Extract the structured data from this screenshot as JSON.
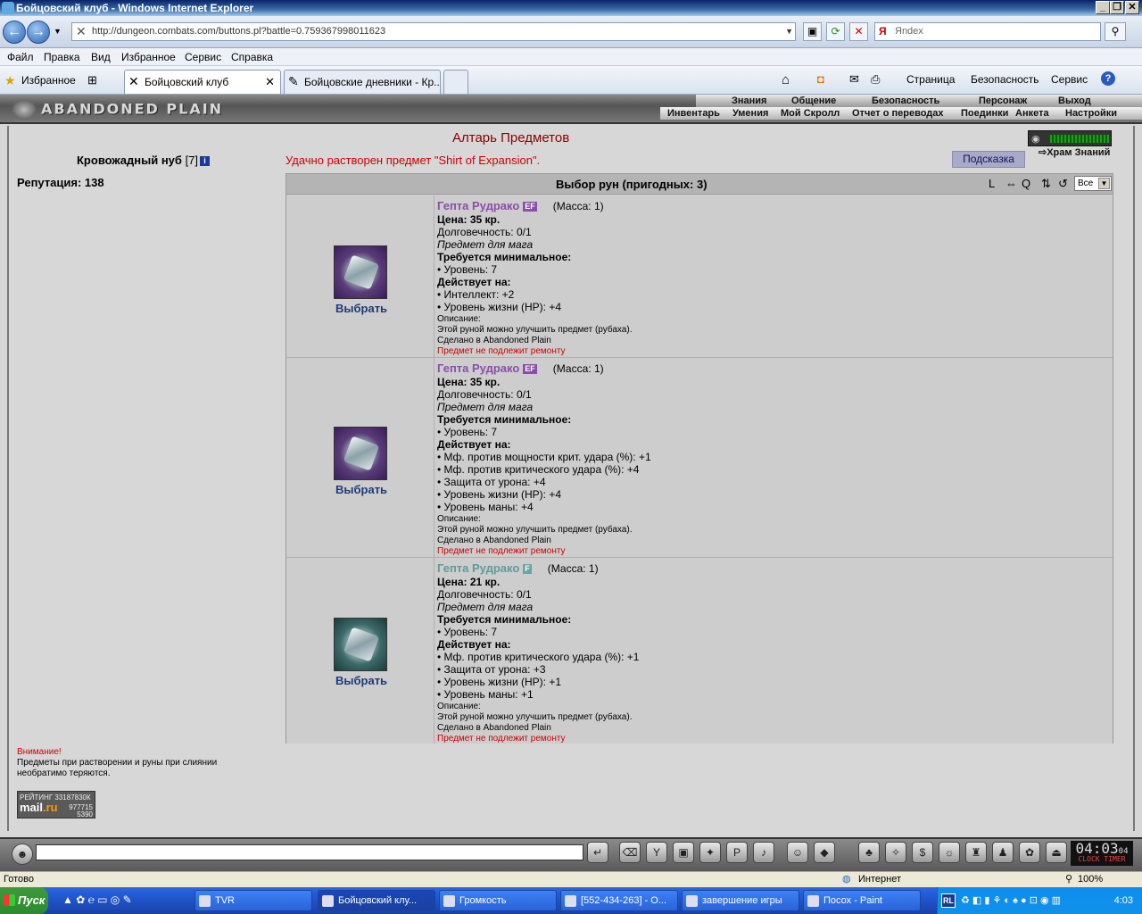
{
  "window": {
    "title": "Бойцовский клуб - Windows Internet Explorer"
  },
  "browser": {
    "url": "http://dungeon.combats.com/buttons.pl?battle=0.759367998011623",
    "search_placeholder": "Яndex",
    "menu": [
      "Файл",
      "Правка",
      "Вид",
      "Избранное",
      "Сервис",
      "Справка"
    ],
    "favorites_label": "Избранное",
    "tabs": [
      {
        "label": "Бойцовский клуб"
      },
      {
        "label": "Бойцовские дневники - Кр..."
      }
    ],
    "commands": [
      "Страница",
      "Безопасность",
      "Сервис"
    ],
    "status": "Готово",
    "zone": "Интернет",
    "zoom": "100%"
  },
  "game": {
    "logo": "ABANDONED PLAIN",
    "nav_top": [
      "Знания",
      "Общение",
      "Безопасность",
      "Персонаж",
      "Выход"
    ],
    "nav_sub": [
      "Инвентарь",
      "Умения",
      "Мой Скролл",
      "Отчет о переводах",
      "Поединки",
      "Анкета",
      "Настройки"
    ],
    "title": "Алтарь Предметов",
    "character": {
      "name": "Кровожадный нуб",
      "level": "[7]",
      "info_icon": "i"
    },
    "reputation": "Репутация: 138",
    "message": "Удачно растворен предмет \"Shirt of Expansion\".",
    "hint_button": "Подсказка",
    "temple_link": "Храм Знаний",
    "panel": {
      "title": "Выбор рун (пригодных: 3)",
      "controls": [
        "L",
        "⇔",
        "Q",
        "⇅",
        "↺"
      ],
      "filter": "Все"
    },
    "items": [
      {
        "name": "Гепта Рудрако",
        "tag": "EF",
        "mass": "(Масса: 1)",
        "price": "Цена: 35 кр.",
        "durability": "Долговечность: 0/1",
        "class": "Предмет для мага",
        "req_header": "Требуется минимальное:",
        "reqs": [
          "• Уровень: 7"
        ],
        "eff_header": "Действует на:",
        "effects": [
          "• Интеллект: +2",
          "• Уровень жизни (HP): +4"
        ],
        "desc_header": "Описание:",
        "desc": "Этой руной можно улучшить предмет (рубаха).",
        "made": "Сделано в Abandoned Plain",
        "repair": "Предмет не подлежит ремонту",
        "select": "Выбрать",
        "color": "purple"
      },
      {
        "name": "Гепта Рудрако",
        "tag": "EF",
        "mass": "(Масса: 1)",
        "price": "Цена: 35 кр.",
        "durability": "Долговечность: 0/1",
        "class": "Предмет для мага",
        "req_header": "Требуется минимальное:",
        "reqs": [
          "• Уровень: 7"
        ],
        "eff_header": "Действует на:",
        "effects": [
          "• Мф. против мощности крит. удара (%): +1",
          "• Мф. против критического удара (%): +4",
          "• Защита от урона: +4",
          "• Уровень жизни (HP): +4",
          "• Уровень маны: +4"
        ],
        "desc_header": "Описание:",
        "desc": "Этой руной можно улучшить предмет (рубаха).",
        "made": "Сделано в Abandoned Plain",
        "repair": "Предмет не подлежит ремонту",
        "select": "Выбрать",
        "color": "purple"
      },
      {
        "name": "Гепта Рудрако",
        "tag": "F",
        "mass": "(Масса: 1)",
        "price": "Цена: 21 кр.",
        "durability": "Долговечность: 0/1",
        "class": "Предмет для мага",
        "req_header": "Требуется минимальное:",
        "reqs": [
          "• Уровень: 7"
        ],
        "eff_header": "Действует на:",
        "effects": [
          "• Мф. против критического удара (%): +1",
          "• Защита от урона: +3",
          "• Уровень жизни (HP): +1",
          "• Уровень маны: +1"
        ],
        "desc_header": "Описание:",
        "desc": "Этой руной можно улучшить предмет (рубаха).",
        "made": "Сделано в Abandoned Plain",
        "repair": "Предмет не подлежит ремонту",
        "select": "Выбрать",
        "color": "teal"
      }
    ],
    "warning": {
      "title": "Внимание!",
      "line1": "Предметы при растворении и руны при слиянии",
      "line2": "необратимо теряются."
    },
    "rating": {
      "label": "РЕЙТИНГ 33187830К",
      "brand": "mail",
      "brand_tld": ".ru",
      "n1": "977715",
      "n2": "5390"
    },
    "clock": {
      "time": "04:03",
      "sec": "04",
      "labels": "CLOCK TIMER"
    }
  },
  "taskbar": {
    "start": "Пуск",
    "items": [
      "TVR",
      "Бойцовский клу...",
      "Громкость",
      "[552-434-263] - О...",
      "завершение игры",
      "Посох - Paint"
    ],
    "lang": "RL",
    "time": "4:03"
  }
}
